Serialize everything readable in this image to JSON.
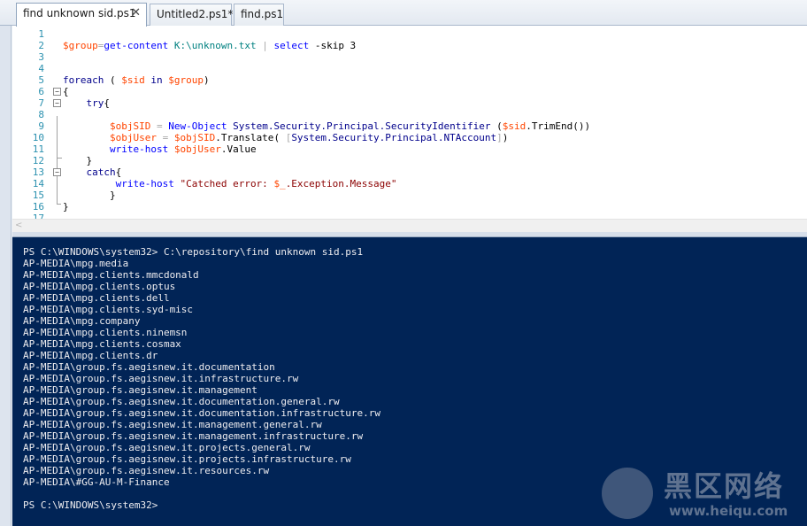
{
  "tabs": [
    {
      "label": "find unknown sid.ps1",
      "close": "✕",
      "active": true
    },
    {
      "label": "Untitled2.ps1*",
      "active": false
    },
    {
      "label": "find.ps1",
      "active": false
    }
  ],
  "editor": {
    "lines": [
      {
        "n": "1",
        "segs": []
      },
      {
        "n": "2",
        "segs": [
          [
            "t-var",
            "$group"
          ],
          [
            "t-op",
            "="
          ],
          [
            "t-cmd",
            "get-content"
          ],
          [
            "t-plain",
            " "
          ],
          [
            "t-type",
            "K:\\unknown.txt"
          ],
          [
            "t-plain",
            " "
          ],
          [
            "t-op",
            "|"
          ],
          [
            "t-plain",
            " "
          ],
          [
            "t-cmd",
            "select"
          ],
          [
            "t-plain",
            " -skip 3"
          ]
        ]
      },
      {
        "n": "3",
        "segs": []
      },
      {
        "n": "4",
        "segs": []
      },
      {
        "n": "5",
        "segs": [
          [
            "t-kw",
            "foreach"
          ],
          [
            "t-plain",
            " ( "
          ],
          [
            "t-var",
            "$sid"
          ],
          [
            "t-plain",
            " "
          ],
          [
            "t-kw",
            "in"
          ],
          [
            "t-plain",
            " "
          ],
          [
            "t-var",
            "$group"
          ],
          [
            "t-plain",
            ")"
          ]
        ]
      },
      {
        "n": "6",
        "segs": [
          [
            "t-plain",
            "{"
          ]
        ]
      },
      {
        "n": "7",
        "segs": [
          [
            "t-plain",
            "    "
          ],
          [
            "t-kw",
            "try"
          ],
          [
            "t-plain",
            "{"
          ]
        ]
      },
      {
        "n": "8",
        "segs": []
      },
      {
        "n": "9",
        "segs": [
          [
            "t-plain",
            "        "
          ],
          [
            "t-var",
            "$objSID"
          ],
          [
            "t-plain",
            " "
          ],
          [
            "t-op",
            "="
          ],
          [
            "t-plain",
            " "
          ],
          [
            "t-cmd",
            "New-Object"
          ],
          [
            "t-plain",
            " "
          ],
          [
            "t-kw",
            "System.Security.Principal.SecurityIdentifier"
          ],
          [
            "t-plain",
            " ("
          ],
          [
            "t-var",
            "$sid"
          ],
          [
            "t-plain",
            "."
          ],
          [
            "t-mem",
            "TrimEnd"
          ],
          [
            "t-plain",
            "())"
          ]
        ]
      },
      {
        "n": "10",
        "segs": [
          [
            "t-plain",
            "        "
          ],
          [
            "t-var",
            "$objUser"
          ],
          [
            "t-plain",
            " "
          ],
          [
            "t-op",
            "="
          ],
          [
            "t-plain",
            " "
          ],
          [
            "t-var",
            "$objSID"
          ],
          [
            "t-plain",
            "."
          ],
          [
            "t-mem",
            "Translate"
          ],
          [
            "t-plain",
            "( "
          ],
          [
            "t-op",
            "["
          ],
          [
            "t-kw",
            "System.Security.Principal.NTAccount"
          ],
          [
            "t-op",
            "]"
          ],
          [
            "t-plain",
            ")"
          ]
        ]
      },
      {
        "n": "11",
        "segs": [
          [
            "t-plain",
            "        "
          ],
          [
            "t-cmd",
            "write-host"
          ],
          [
            "t-plain",
            " "
          ],
          [
            "t-var",
            "$objUser"
          ],
          [
            "t-plain",
            "."
          ],
          [
            "t-mem",
            "Value"
          ]
        ]
      },
      {
        "n": "12",
        "segs": [
          [
            "t-plain",
            "    }"
          ]
        ]
      },
      {
        "n": "13",
        "segs": [
          [
            "t-plain",
            "    "
          ],
          [
            "t-kw",
            "catch"
          ],
          [
            "t-plain",
            "{"
          ]
        ]
      },
      {
        "n": "14",
        "segs": [
          [
            "t-plain",
            "         "
          ],
          [
            "t-cmd",
            "write-host"
          ],
          [
            "t-plain",
            " "
          ],
          [
            "t-str",
            "\"Catched error: "
          ],
          [
            "t-var",
            "$_"
          ],
          [
            "t-str",
            ".Exception.Message\""
          ]
        ]
      },
      {
        "n": "15",
        "segs": [
          [
            "t-plain",
            "        }"
          ]
        ]
      },
      {
        "n": "16",
        "segs": [
          [
            "t-plain",
            "}"
          ]
        ]
      },
      {
        "n": "17",
        "segs": []
      }
    ]
  },
  "scrollbar": {
    "left_arrow": "<"
  },
  "console": {
    "lines": [
      "PS C:\\WINDOWS\\system32> C:\\repository\\find unknown sid.ps1",
      "AP-MEDIA\\mpg.media",
      "AP-MEDIA\\mpg.clients.mmcdonald",
      "AP-MEDIA\\mpg.clients.optus",
      "AP-MEDIA\\mpg.clients.dell",
      "AP-MEDIA\\mpg.clients.syd-misc",
      "AP-MEDIA\\mpg.company",
      "AP-MEDIA\\mpg.clients.ninemsn",
      "AP-MEDIA\\mpg.clients.cosmax",
      "AP-MEDIA\\mpg.clients.dr",
      "AP-MEDIA\\group.fs.aegisnew.it.documentation",
      "AP-MEDIA\\group.fs.aegisnew.it.infrastructure.rw",
      "AP-MEDIA\\group.fs.aegisnew.it.management",
      "AP-MEDIA\\group.fs.aegisnew.it.documentation.general.rw",
      "AP-MEDIA\\group.fs.aegisnew.it.documentation.infrastructure.rw",
      "AP-MEDIA\\group.fs.aegisnew.it.management.general.rw",
      "AP-MEDIA\\group.fs.aegisnew.it.management.infrastructure.rw",
      "AP-MEDIA\\group.fs.aegisnew.it.projects.general.rw",
      "AP-MEDIA\\group.fs.aegisnew.it.projects.infrastructure.rw",
      "AP-MEDIA\\group.fs.aegisnew.it.resources.rw",
      "AP-MEDIA\\#GG-AU-M-Finance",
      "",
      "PS C:\\WINDOWS\\system32>"
    ]
  },
  "watermark": {
    "title": "黑区网络",
    "url": "www.heiqu.com"
  },
  "colors": {
    "console_bg": "#012456",
    "console_fg": "#eeedf0",
    "variable": "#ff4500",
    "cmdlet": "#0000ff",
    "keyword": "#00008b",
    "string": "#8b0000",
    "line_number": "#2b91af"
  }
}
